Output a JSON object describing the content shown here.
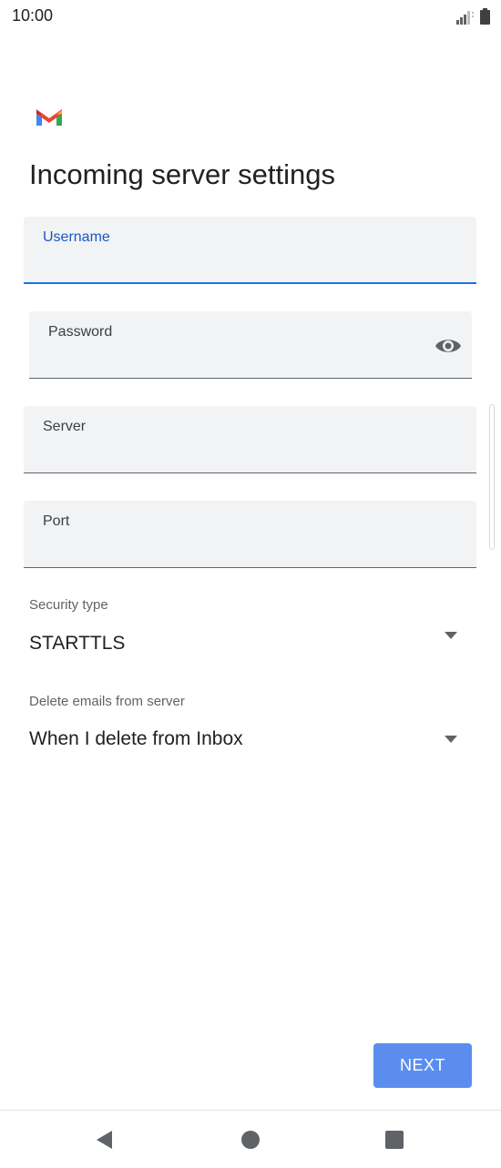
{
  "status_bar": {
    "time": "10:00",
    "signal_icon": "signal-icon",
    "battery_icon": "battery-icon"
  },
  "app": {
    "logo_icon": "gmail-logo-icon"
  },
  "page": {
    "title": "Incoming server settings"
  },
  "fields": {
    "username": {
      "label": "Username",
      "value": ""
    },
    "password": {
      "label": "Password",
      "value": "",
      "visibility_icon": "eye-icon"
    },
    "server": {
      "label": "Server",
      "value": ""
    },
    "port": {
      "label": "Port",
      "value": ""
    }
  },
  "security": {
    "label": "Security type",
    "value": "STARTTLS"
  },
  "delete_policy": {
    "label": "Delete emails from server",
    "value": "When I delete from Inbox"
  },
  "actions": {
    "next_label": "NEXT"
  },
  "nav": {
    "back": "back-icon",
    "home": "home-icon",
    "recents": "recents-icon"
  },
  "colors": {
    "accent": "#1a73e8",
    "button": "#5b8def",
    "field_bg": "#f1f3f4"
  }
}
